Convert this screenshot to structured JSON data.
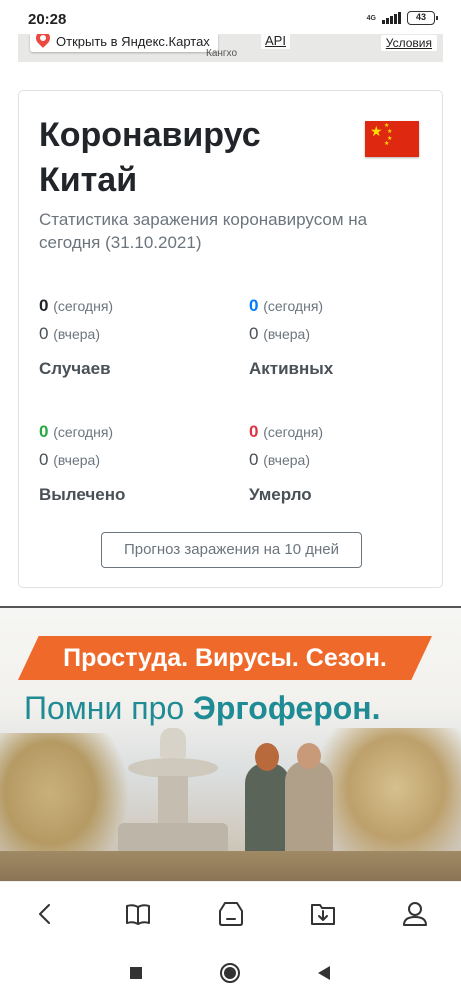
{
  "status": {
    "time": "20:28",
    "network": "4G",
    "battery": "43"
  },
  "map": {
    "open_link": "Открыть в Яндекс.Картах",
    "api_link": "API",
    "city_label": "Кангхо",
    "terms_link": "Условия"
  },
  "card": {
    "title_line1": "Коронавирус",
    "title_line2": "Китай",
    "subtitle": "Статистика заражения коронавирусом на сегодня (31.10.2021)",
    "today_suffix": "(сегодня)",
    "yesterday_suffix": "(вчера)",
    "stats": {
      "cases": {
        "today": "0",
        "yesterday": "0",
        "label": "Случаев"
      },
      "active": {
        "today": "0",
        "yesterday": "0",
        "label": "Активных"
      },
      "recovered": {
        "today": "0",
        "yesterday": "0",
        "label": "Вылечено"
      },
      "deaths": {
        "today": "0",
        "yesterday": "0",
        "label": "Умерло"
      }
    },
    "forecast_button": "Прогноз заражения на 10 дней"
  },
  "ad": {
    "banner_text": "Простуда. Вирусы. Сезон.",
    "line2_prefix": "Помни про ",
    "line2_brand": "Эргоферон."
  },
  "bottom_nav": [
    "back-icon",
    "bookmarks-icon",
    "tabs-icon",
    "downloads-icon",
    "profile-icon"
  ],
  "system_nav": [
    "recent-apps-icon",
    "home-icon",
    "back-triangle-icon"
  ],
  "colors": {
    "active": "#007bff",
    "recovered": "#28a745",
    "deaths": "#dc3545",
    "ad_orange": "#ef6a2a",
    "ad_teal": "#1f8b95",
    "flag_red": "#de2910",
    "flag_yellow": "#ffde00"
  }
}
